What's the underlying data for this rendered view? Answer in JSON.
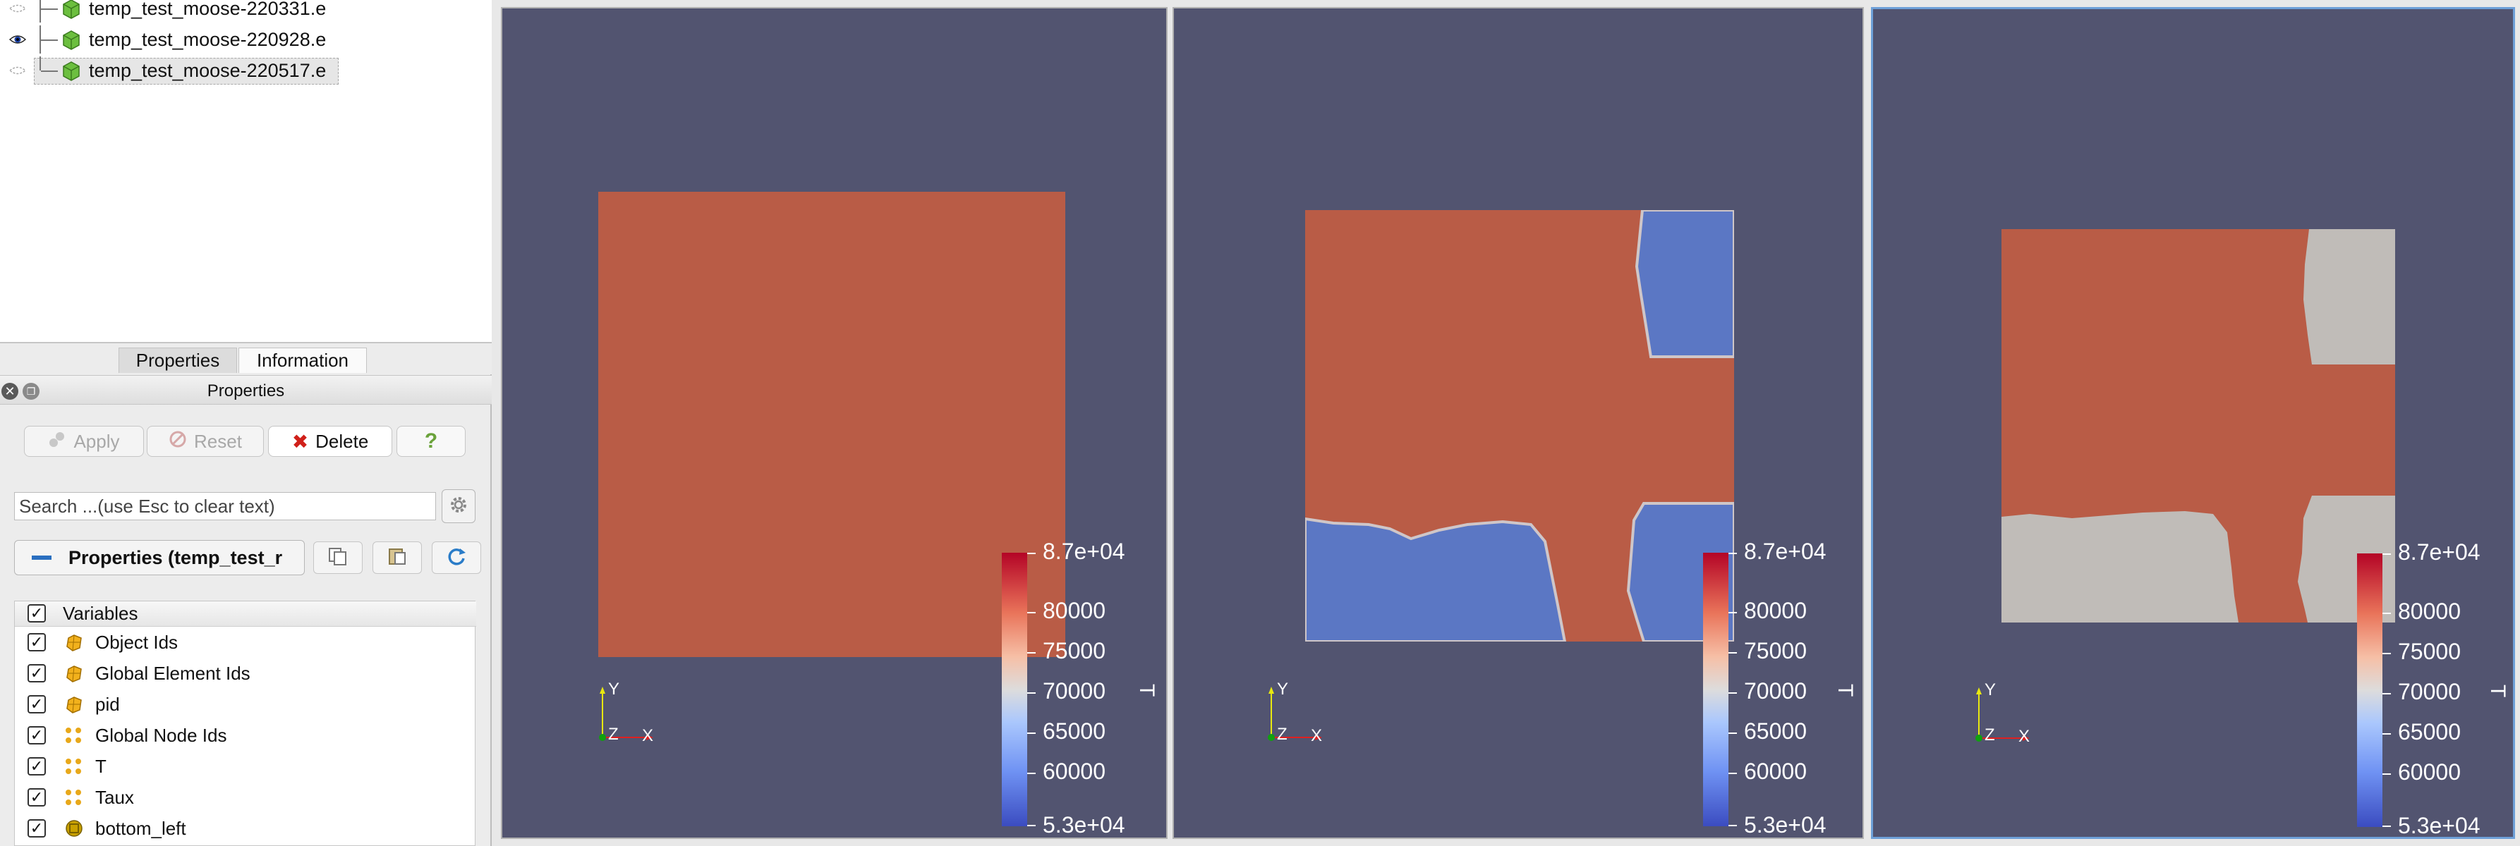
{
  "pipeline": {
    "items": [
      {
        "label": "temp_test_moose-220331.e",
        "visible": false
      },
      {
        "label": "temp_test_moose-220928.e",
        "visible": true
      },
      {
        "label": "temp_test_moose-220517.e",
        "visible": false,
        "selected": true
      }
    ]
  },
  "tabs": {
    "properties": "Properties",
    "information": "Information"
  },
  "panel": {
    "title": "Properties",
    "apply": "Apply",
    "reset": "Reset",
    "delete": "Delete",
    "help": "?",
    "search_placeholder": "Search ...(use Esc to clear text)",
    "section_label": "Properties (temp_test_r"
  },
  "variables": {
    "header": "Variables",
    "items": [
      {
        "label": "Object Ids",
        "icon": "cell-data-icon"
      },
      {
        "label": "Global Element Ids",
        "icon": "cell-data-icon"
      },
      {
        "label": "pid",
        "icon": "cell-data-icon"
      },
      {
        "label": "Global Node Ids",
        "icon": "point-data-icon"
      },
      {
        "label": "T",
        "icon": "point-data-icon"
      },
      {
        "label": "Taux",
        "icon": "point-data-icon"
      },
      {
        "label": "bottom_left",
        "icon": "field-data-icon"
      }
    ]
  },
  "colorbar": {
    "title": "T",
    "max_label": "8.7e+04",
    "min_label": "5.3e+04",
    "ticks": [
      "80000",
      "75000",
      "70000",
      "65000",
      "60000"
    ]
  },
  "axes": {
    "y": "Y",
    "z": "Z",
    "x": "X"
  },
  "colors": {
    "background": "#525470",
    "hot": "#b95c46",
    "cold": "#5b77c4",
    "mid": "#c0bcb8",
    "selected_border": "#6ea0d8"
  }
}
